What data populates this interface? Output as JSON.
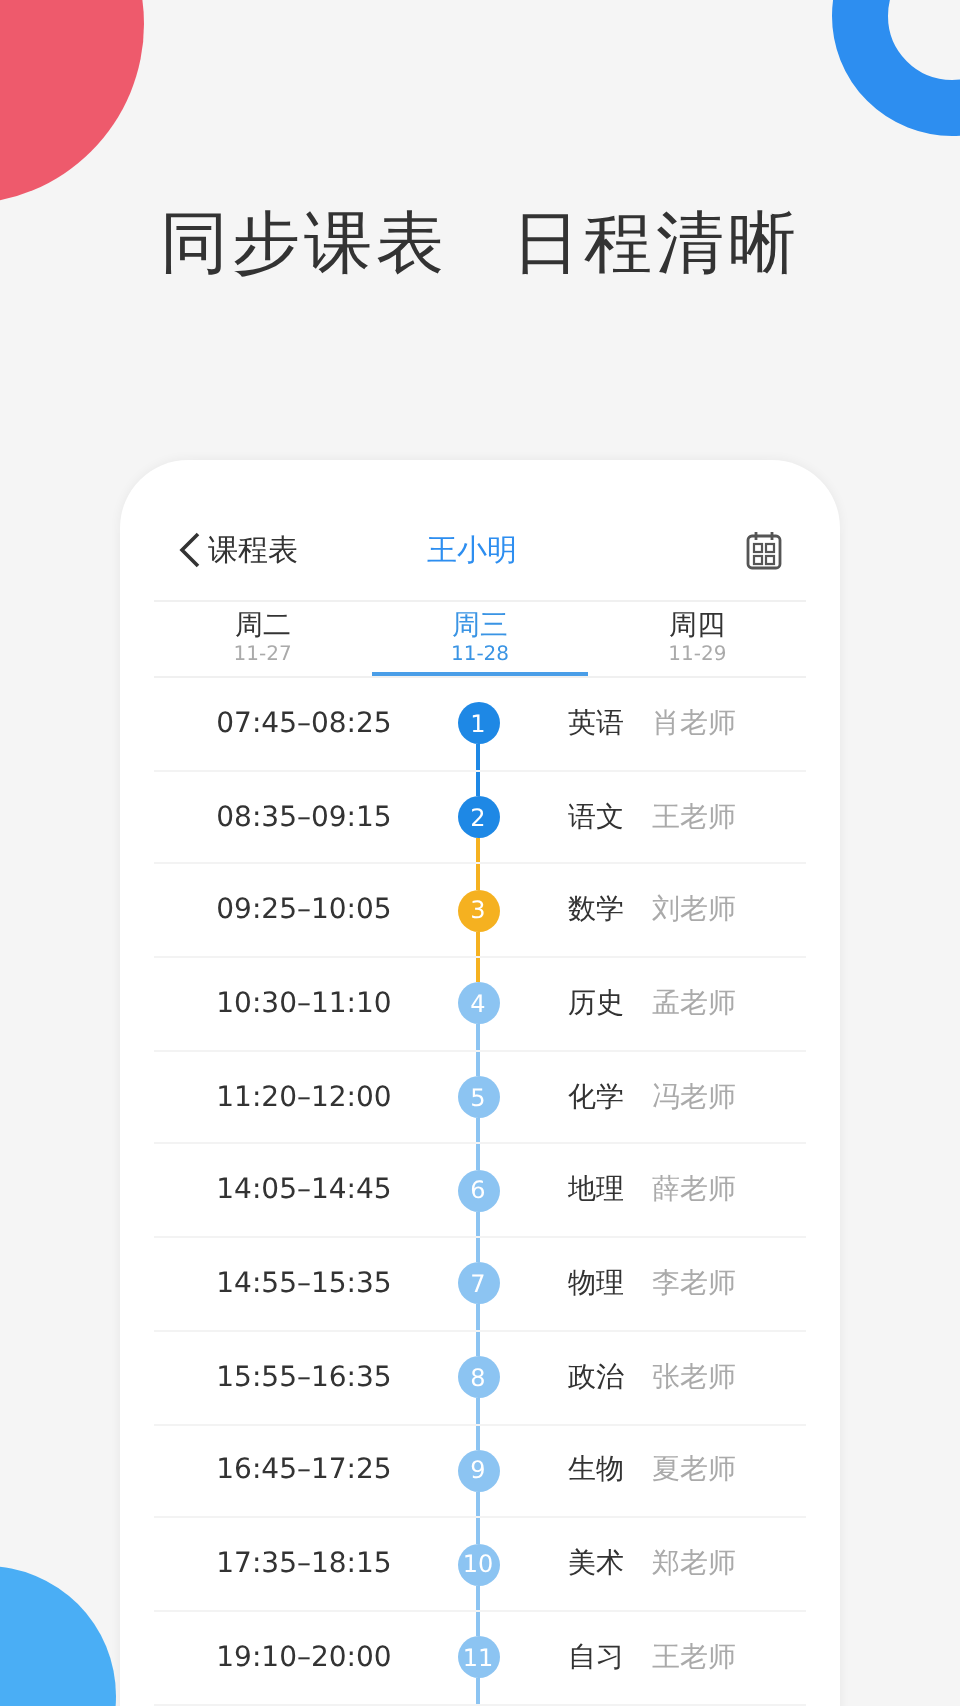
{
  "headline": [
    "同步课表",
    "日程清晰"
  ],
  "header": {
    "back_label": "课程表",
    "student": "王小明"
  },
  "tabs": [
    {
      "day": "周二",
      "date": "11-27",
      "selected": false
    },
    {
      "day": "周三",
      "date": "11-28",
      "selected": true
    },
    {
      "day": "周四",
      "date": "11-29",
      "selected": false
    }
  ],
  "lessons": [
    {
      "time": "07:45–08:25",
      "index": "1",
      "subject": "英语",
      "teacher": "肖老师",
      "color": "#1e88e5"
    },
    {
      "time": "08:35–09:15",
      "index": "2",
      "subject": "语文",
      "teacher": "王老师",
      "color": "#1e88e5"
    },
    {
      "time": "09:25–10:05",
      "index": "3",
      "subject": "数学",
      "teacher": "刘老师",
      "color": "#f5b120"
    },
    {
      "time": "10:30–11:10",
      "index": "4",
      "subject": "历史",
      "teacher": "孟老师",
      "color": "#8cc4f2"
    },
    {
      "time": "11:20–12:00",
      "index": "5",
      "subject": "化学",
      "teacher": "冯老师",
      "color": "#8cc4f2"
    },
    {
      "time": "14:05–14:45",
      "index": "6",
      "subject": "地理",
      "teacher": "薛老师",
      "color": "#8cc4f2"
    },
    {
      "time": "14:55–15:35",
      "index": "7",
      "subject": "物理",
      "teacher": "李老师",
      "color": "#8cc4f2"
    },
    {
      "time": "15:55–16:35",
      "index": "8",
      "subject": "政治",
      "teacher": "张老师",
      "color": "#8cc4f2"
    },
    {
      "time": "16:45–17:25",
      "index": "9",
      "subject": "生物",
      "teacher": "夏老师",
      "color": "#8cc4f2"
    },
    {
      "time": "17:35–18:15",
      "index": "10",
      "subject": "美术",
      "teacher": "郑老师",
      "color": "#8cc4f2"
    },
    {
      "time": "19:10–20:00",
      "index": "11",
      "subject": "自习",
      "teacher": "王老师",
      "color": "#8cc4f2"
    }
  ]
}
